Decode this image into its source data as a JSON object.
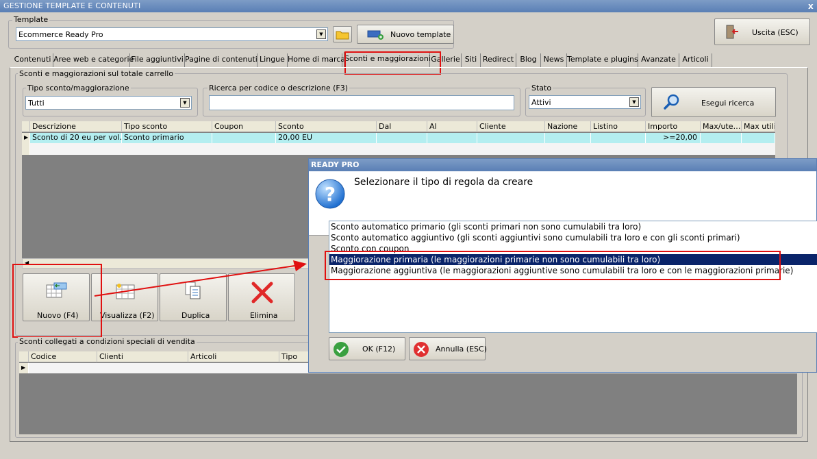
{
  "window": {
    "title": "GESTIONE TEMPLATE E CONTENUTI",
    "close_glyph": "x"
  },
  "template_group": {
    "label": "Template",
    "selected": "Ecommerce Ready Pro",
    "new_template_button": "Nuovo template"
  },
  "exit_button": "Uscita (ESC)",
  "tabs": [
    "Contenuti",
    "Aree web e categorie",
    "File aggiuntivi",
    "Pagine di contenuti",
    "Lingue",
    "Home di marca",
    "Sconti e maggiorazioni",
    "Gallerie",
    "Siti",
    "Redirect",
    "Blog",
    "News",
    "Template e plugins",
    "Avanzate",
    "Articoli"
  ],
  "cart_section": {
    "label": "Sconti e maggiorazioni sul totale carrello",
    "filter_type": {
      "label": "Tipo sconto/maggiorazione",
      "value": "Tutti"
    },
    "search": {
      "label": "Ricerca per codice o descrizione (F3)",
      "value": ""
    },
    "state": {
      "label": "Stato",
      "value": "Attivi"
    },
    "search_button": "Esegui ricerca",
    "table": {
      "columns": [
        "Descrizione",
        "Tipo sconto",
        "Coupon",
        "Sconto",
        "Dal",
        "Al",
        "Cliente",
        "Nazione",
        "Listino",
        "Importo",
        "Max/ute…",
        "Max utiliz"
      ],
      "rows": [
        [
          "Sconto di 20 eu per vol…",
          "Sconto primario",
          "",
          "20,00 EU",
          "",
          "",
          "",
          "",
          "",
          ">=20,00",
          "",
          ""
        ]
      ]
    },
    "actions": {
      "new": "Nuovo (F4)",
      "view": "Visualizza (F2)",
      "duplicate": "Duplica",
      "delete": "Elimina"
    }
  },
  "special_section": {
    "label": "Sconti collegati a condizioni speciali di vendita",
    "table": {
      "columns": [
        "Codice",
        "Clienti",
        "Articoli",
        "Tipo"
      ]
    }
  },
  "dialog": {
    "title": "READY PRO",
    "prompt": "Selezionare il tipo di regola da creare",
    "options": [
      "Sconto automatico primario (gli sconti primari non sono cumulabili tra loro)",
      "Sconto automatico aggiuntivo (gli sconti aggiuntivi sono cumulabili tra loro e con gli sconti primari)",
      "Sconto con coupon",
      "Maggiorazione primaria (le maggiorazioni primarie non sono cumulabili tra loro)",
      "Maggiorazione aggiuntiva (le maggiorazioni aggiuntive sono cumulabili tra loro e con le maggiorazioni primarie)"
    ],
    "selected_index": 3,
    "ok_button": "OK (F12)",
    "cancel_button": "Annulla (ESC)",
    "question_glyph": "?"
  },
  "colors": {
    "titlebar": "#5a7fb5",
    "row_highlight": "#b4eef0",
    "grid_empty": "#808080",
    "selection": "#0a246a",
    "annotation_red": "#e01010"
  }
}
